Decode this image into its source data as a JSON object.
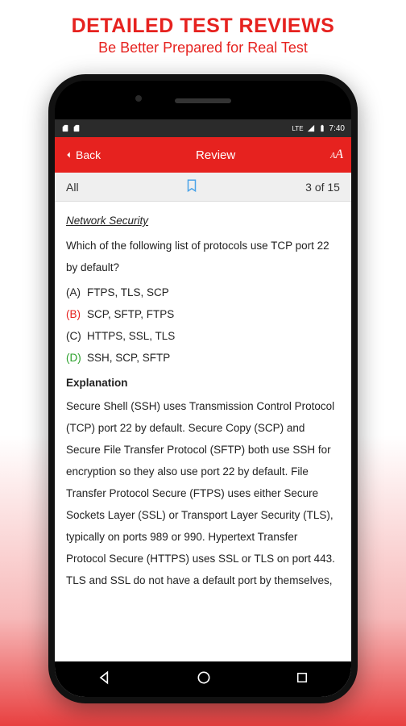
{
  "promo": {
    "title": "DETAILED TEST REVIEWS",
    "subtitle": "Be Better Prepared for Real Test"
  },
  "statusbar": {
    "signal": "LTE",
    "time": "7:40"
  },
  "appbar": {
    "back": "Back",
    "title": "Review"
  },
  "filter": {
    "all": "All",
    "counter": "3 of 15"
  },
  "review": {
    "category": "Network Security",
    "question": "Which of the following list of protocols use TCP port 22 by default?",
    "options": [
      {
        "letter": "(A)",
        "text": "FTPS, TLS, SCP",
        "state": "normal"
      },
      {
        "letter": "(B)",
        "text": "SCP, SFTP, FTPS",
        "state": "wrong"
      },
      {
        "letter": "(C)",
        "text": "HTTPS, SSL, TLS",
        "state": "normal"
      },
      {
        "letter": "(D)",
        "text": "SSH, SCP, SFTP",
        "state": "right"
      }
    ],
    "explanation_title": "Explanation",
    "explanation": "Secure Shell (SSH) uses Transmission Control Protocol (TCP) port 22 by default. Secure Copy (SCP) and Secure File Transfer Protocol (SFTP) both use SSH for encryption so they also use port 22 by default. File Transfer Protocol Secure (FTPS) uses either Secure Sockets Layer (SSL) or Transport Layer Security (TLS), typically on ports 989 or 990. Hypertext Transfer Protocol Secure (HTTPS) uses SSL or TLS on port 443. TLS and SSL do not have a default port by themselves,"
  }
}
